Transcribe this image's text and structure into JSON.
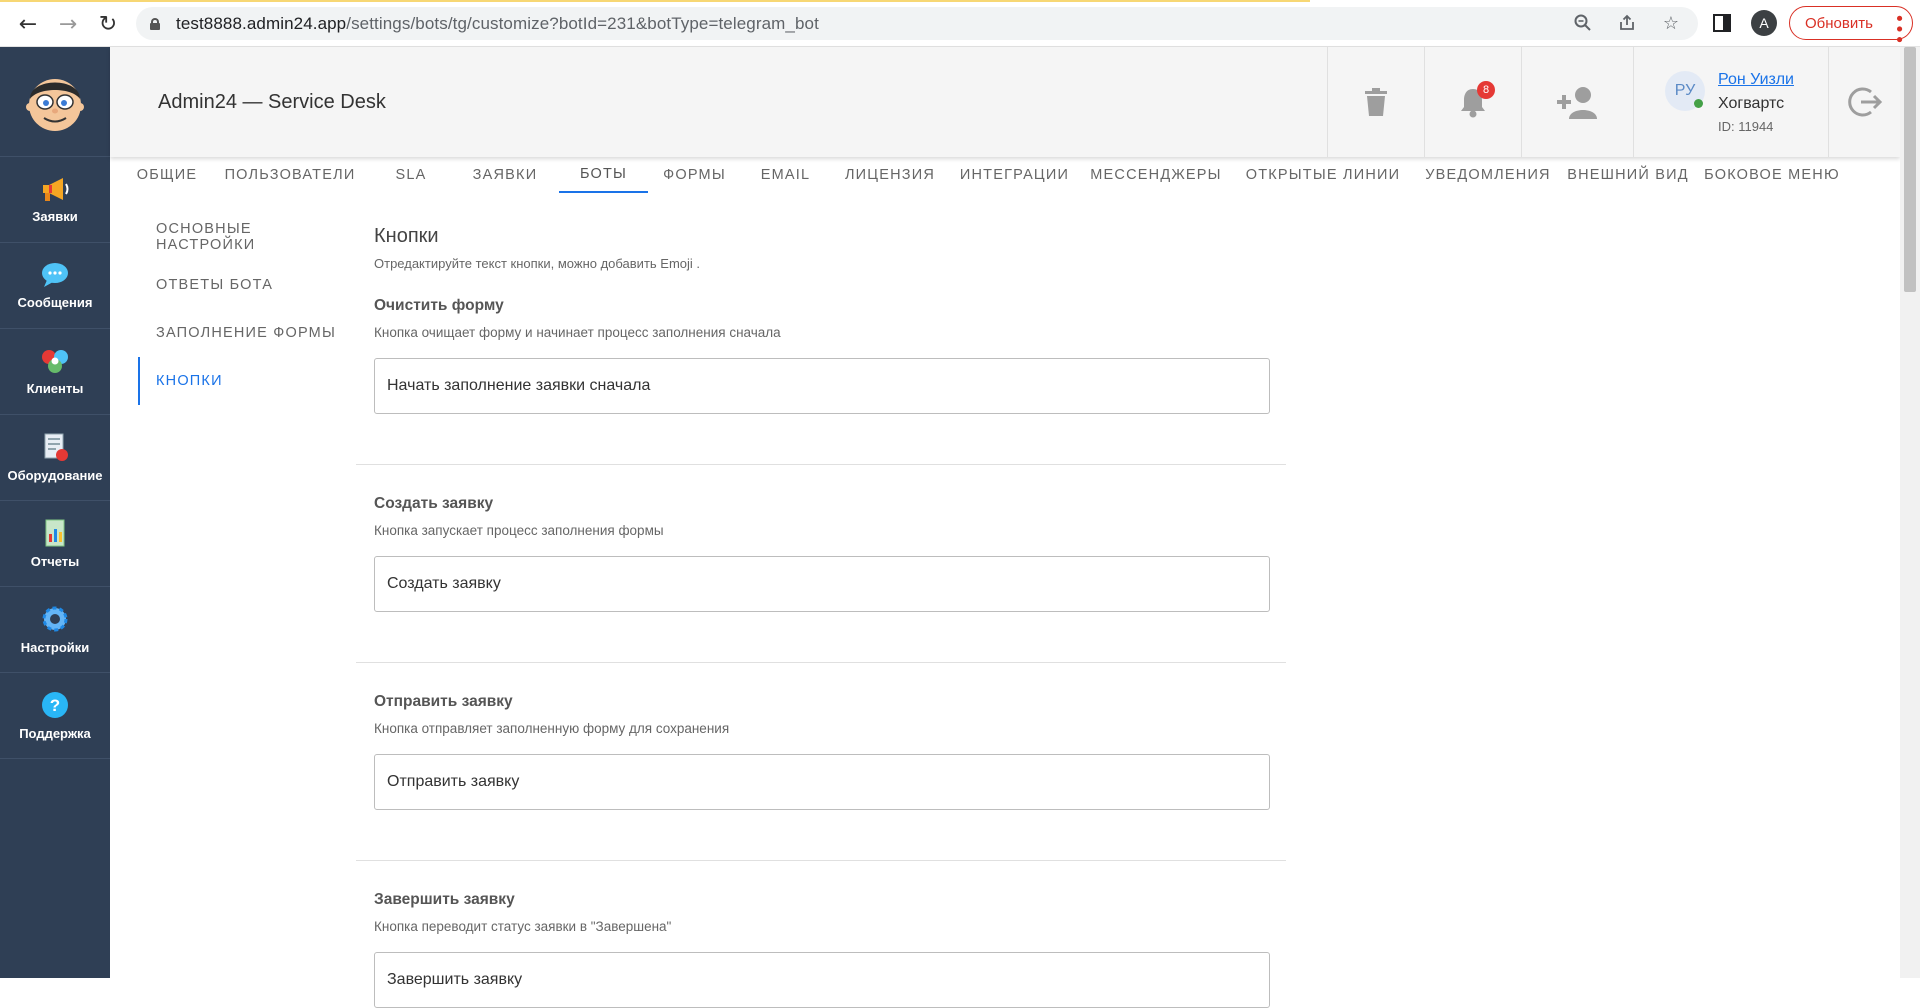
{
  "browser": {
    "url_host": "test8888.admin24.app",
    "url_path": "/settings/bots/tg/customize?botId=231&botType=telegram_bot",
    "profile_initial": "A",
    "update_label": "Обновить"
  },
  "sidebar": {
    "items": [
      {
        "label": "Заявки",
        "icon": "megaphone-icon"
      },
      {
        "label": "Сообщения",
        "icon": "chat-bubble-icon"
      },
      {
        "label": "Клиенты",
        "icon": "clients-icon"
      },
      {
        "label": "Оборудование",
        "icon": "equipment-icon"
      },
      {
        "label": "Отчеты",
        "icon": "report-icon"
      },
      {
        "label": "Настройки",
        "icon": "gear-icon"
      },
      {
        "label": "Поддержка",
        "icon": "help-icon"
      }
    ]
  },
  "header": {
    "title": "Admin24 — Service Desk",
    "notifications_count": "8",
    "user": {
      "initials": "РУ",
      "name": "Рон Уизли",
      "org": "Хогвартс",
      "id": "ID: 11944"
    }
  },
  "tabs": [
    "Общие",
    "Пользователи",
    "SLA",
    "Заявки",
    "Боты",
    "Формы",
    "Email",
    "Лицензия",
    "Интеграции",
    "Мессенджеры",
    "Открытые линии",
    "Уведомления",
    "Внешний вид",
    "Боковое меню"
  ],
  "active_tab": "Боты",
  "subnav": [
    "Основные настройки",
    "Ответы бота",
    "Заполнение формы",
    "Кнопки"
  ],
  "active_subnav": "Кнопки",
  "content": {
    "title": "Кнопки",
    "description": "Отредактируйте текст кнопки, можно добавить Emoji .",
    "fields": [
      {
        "title": "Очистить форму",
        "desc": "Кнопка очищает форму и начинает процесс заполнения сначала",
        "value": "Начать заполнение заявки сначала"
      },
      {
        "title": "Создать заявку",
        "desc": "Кнопка запускает процесс заполнения формы",
        "value": "Создать заявку"
      },
      {
        "title": "Отправить заявку",
        "desc": "Кнопка отправляет заполненную форму для сохранения",
        "value": "Отправить заявку"
      },
      {
        "title": "Завершить заявку",
        "desc": "Кнопка переводит статус заявки в \"Завершена\"",
        "value": "Завершить заявку"
      }
    ]
  },
  "colors": {
    "sidebar_bg": "#2f3f55",
    "accent": "#1a73e8",
    "badge": "#e53935",
    "update": "#d93025"
  }
}
